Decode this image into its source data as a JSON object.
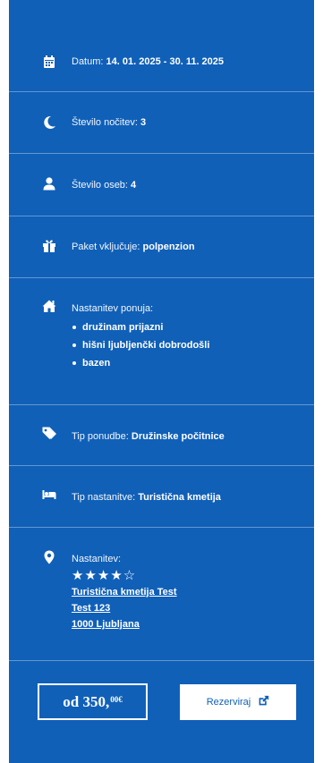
{
  "details": {
    "date": {
      "label": "Datum:",
      "value": "14. 01. 2025 - 30. 11. 2025",
      "icon": "calendar-icon"
    },
    "nights": {
      "label": "Število nočitev:",
      "value": "3",
      "icon": "moon-icon"
    },
    "persons": {
      "label": "Število oseb:",
      "value": "4",
      "icon": "user-icon"
    },
    "package": {
      "label": "Paket vključuje:",
      "value": "polpenzion",
      "icon": "gift-icon"
    },
    "accommodation_offer": {
      "label": "Nastanitev ponuja:",
      "icon": "home-icon",
      "items": [
        "družinam prijazni",
        "hišni ljubljenčki dobrodošli",
        "bazen"
      ]
    },
    "offer_type": {
      "label": "Tip ponudbe:",
      "value": "Družinske počitnice",
      "icon": "tags-icon"
    },
    "accommodation_type": {
      "label": "Tip nastanitve:",
      "value": "Turistična kmetija",
      "icon": "bed-icon"
    },
    "location": {
      "label": "Nastanitev:",
      "icon": "map-marker-icon",
      "stars": "★★★★☆",
      "rating": 4,
      "name": "Turistična kmetija Test",
      "street": "Test 123",
      "city": "1000 Ljubljana"
    }
  },
  "footer": {
    "price_prefix": "od 350,",
    "price_cents": "00",
    "currency": "€",
    "book_label": "Rezerviraj",
    "book_icon": "external-link-icon"
  },
  "colors": {
    "panel_bg": "#1060b8",
    "text": "#ffffff",
    "button_bg": "#ffffff"
  }
}
